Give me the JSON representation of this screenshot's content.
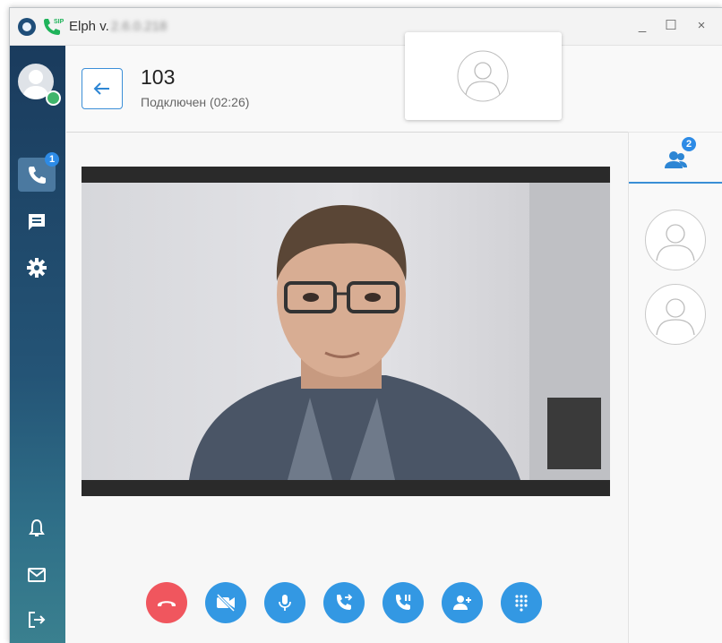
{
  "window": {
    "title": "Elph v.",
    "version": "2.6.0.218",
    "controls": {
      "minimize": "_",
      "maximize": "☐",
      "close": "×"
    }
  },
  "sidebar": {
    "user_status": "online",
    "nav": [
      {
        "id": "calls",
        "icon": "phone-icon",
        "badge": "1",
        "active": true
      },
      {
        "id": "messages",
        "icon": "chat-icon"
      },
      {
        "id": "settings",
        "icon": "gear-icon"
      }
    ],
    "bottom": [
      {
        "id": "notifications",
        "icon": "bell-icon"
      },
      {
        "id": "mail",
        "icon": "envelope-icon"
      },
      {
        "id": "logout",
        "icon": "logout-icon"
      }
    ]
  },
  "call": {
    "contact": "103",
    "status": "Подключен (02:26)"
  },
  "controls": [
    {
      "id": "hangup",
      "icon": "hangup-icon",
      "color": "#f0565e"
    },
    {
      "id": "video-off",
      "icon": "video-off-icon",
      "color": "#3398e3"
    },
    {
      "id": "microphone",
      "icon": "microphone-icon",
      "color": "#3398e3"
    },
    {
      "id": "transfer",
      "icon": "transfer-icon",
      "color": "#3398e3"
    },
    {
      "id": "hold",
      "icon": "hold-icon",
      "color": "#3398e3"
    },
    {
      "id": "add-participant",
      "icon": "add-user-icon",
      "color": "#3398e3"
    },
    {
      "id": "keypad",
      "icon": "keypad-icon",
      "color": "#3398e3"
    }
  ],
  "participants_panel": {
    "tab_badge": "2",
    "participants": [
      {
        "icon": "avatar-icon"
      },
      {
        "icon": "avatar-icon"
      }
    ]
  },
  "colors": {
    "accent": "#3398e3",
    "hangup": "#f0565e",
    "sidebar": "#1a3b5d"
  }
}
